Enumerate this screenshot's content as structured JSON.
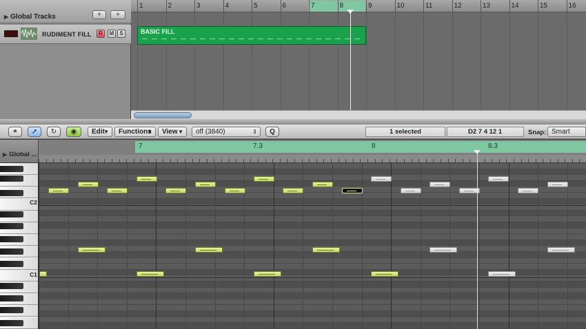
{
  "global_tracks": {
    "title": "Global Tracks",
    "add_button": "+",
    "folder_button": "+"
  },
  "track": {
    "name": "RUDIMENT FILL",
    "record": "R",
    "mute": "M",
    "solo": "S"
  },
  "ruler": {
    "bars": [
      "1",
      "2",
      "3",
      "4",
      "5",
      "6",
      "7",
      "8",
      "9",
      "10",
      "11",
      "12",
      "13",
      "14",
      "15",
      "16"
    ]
  },
  "region": {
    "name": "BASIC FILL"
  },
  "piano_roll": {
    "toolbar": {
      "edit": "Edit",
      "functions": "Functions",
      "view": "View",
      "quantize_value": "off (3840)",
      "q_button": "Q",
      "status": "1 selected",
      "position": "D2   7 4 12 1",
      "snap_label": "Snap:",
      "snap_value": "Smart"
    },
    "global_label": "Global ...",
    "ruler_bars": [
      "7",
      "7.3",
      "8",
      "8.3"
    ],
    "key_labels": [
      "C2",
      "C1"
    ],
    "note_color": "#cde07f",
    "ghost_note_color": "#dddddd"
  }
}
